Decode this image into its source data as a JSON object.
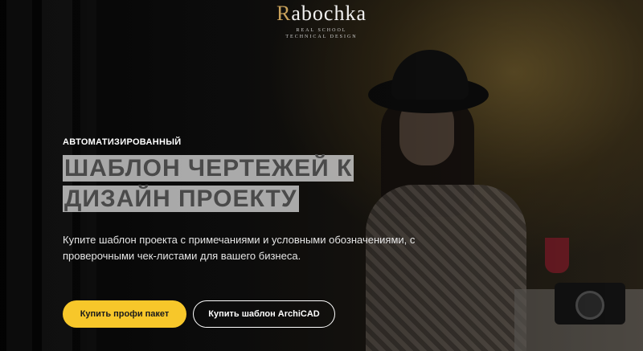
{
  "brand": {
    "name_first": "R",
    "name_rest": "abochka",
    "tagline_line1": "REAL SCHOOL",
    "tagline_line2": "TECHNICAL DESIGN",
    "accent_color": "#c9a25b"
  },
  "hero": {
    "eyebrow": "АВТОМАТИЗИРОВАННЫЙ",
    "title_line1": "ШАБЛОН ЧЕРТЕЖЕЙ К",
    "title_line2": "ДИЗАЙН ПРОЕКТУ",
    "description": "Купите шаблон проекта с примечаниями и условными обозначениями, с проверочными чек-листами для вашего бизнеса.",
    "primary_button": "Купить профи пакет",
    "secondary_button": "Купить шаблон ArchiCAD",
    "primary_color": "#f7c72a"
  }
}
